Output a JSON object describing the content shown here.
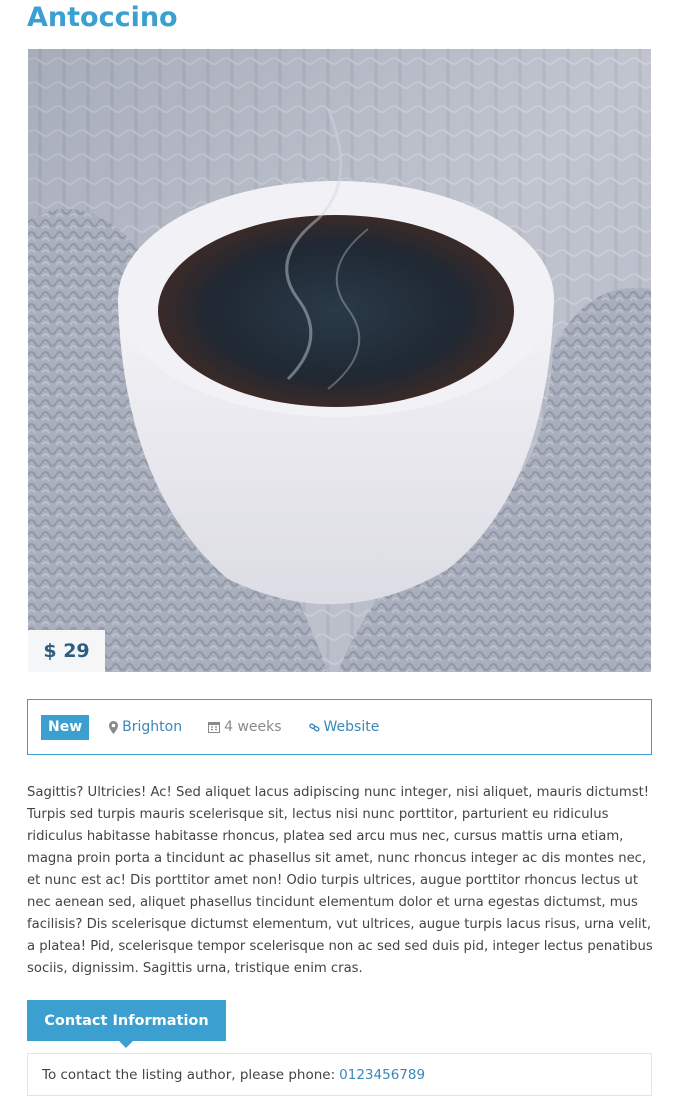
{
  "listing": {
    "title": "Antoccino",
    "price": "$ 29",
    "badge": "New",
    "location": "Brighton",
    "duration": "4 weeks",
    "website": "Website",
    "description": "Sagittis? Ultricies! Ac! Sed aliquet lacus adipiscing nunc integer, nisi aliquet, mauris dictumst! Turpis sed turpis mauris scelerisque sit, lectus nisi nunc porttitor, parturient eu ridiculus ridiculus habitasse habitasse rhoncus, platea sed arcu mus nec, cursus mattis urna etiam, magna proin porta a tincidunt ac phasellus sit amet, nunc rhoncus integer ac dis montes nec, et nunc est ac! Dis porttitor amet non! Odio turpis ultrices, augue porttitor rhoncus lectus ut nec aenean sed, aliquet phasellus tincidunt elementum dolor et urna egestas dictumst, mus facilisis? Dis scelerisque dictumst elementum, vut ultrices, augue turpis lacus risus, urna velit, a platea! Pid, scelerisque tempor scelerisque non ac sed sed duis pid, integer lectus penatibus sociis, dignissim. Sagittis urna, tristique enim cras."
  },
  "contact": {
    "button_label": "Contact Information",
    "text": "To contact the listing author, please phone:",
    "phone": "0123456789"
  },
  "icons": {
    "location": "map-marker-icon",
    "duration": "calendar-icon",
    "website": "link-icon"
  },
  "colors": {
    "accent": "#3b9fcf",
    "link": "#3b87b8"
  }
}
